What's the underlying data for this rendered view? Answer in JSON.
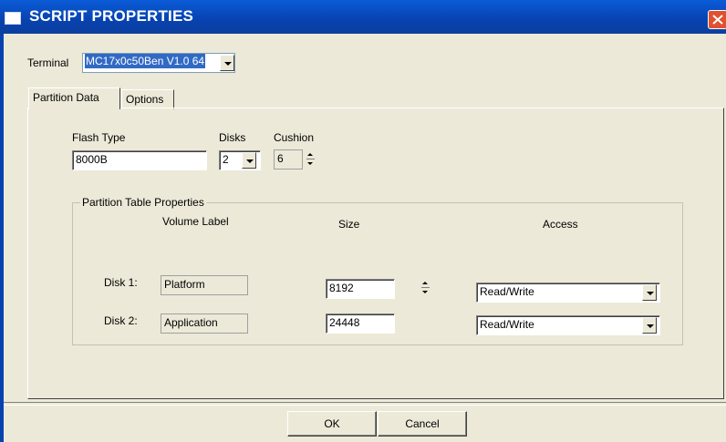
{
  "window": {
    "title": "SCRIPT PROPERTIES"
  },
  "terminal": {
    "label": "Terminal",
    "value": "MC17x0c50Ben V1.0 64"
  },
  "tabs": [
    {
      "label": "Partition Data",
      "active": true
    },
    {
      "label": "Options",
      "active": false
    }
  ],
  "partition": {
    "flash_type_label": "Flash Type",
    "flash_type_value": "8000B",
    "disks_label": "Disks",
    "disks_value": "2",
    "cushion_label": "Cushion",
    "cushion_value": "6",
    "group_title": "Partition Table Properties",
    "col_volume": "Volume Label",
    "col_size": "Size",
    "col_access": "Access",
    "rows": [
      {
        "disk": "Disk 1:",
        "volume": "Platform",
        "size": "8192",
        "access": "Read/Write"
      },
      {
        "disk": "Disk 2:",
        "volume": "Application",
        "size": "24448",
        "access": "Read/Write"
      }
    ]
  },
  "buttons": {
    "ok": "OK",
    "cancel": "Cancel"
  },
  "icons": {
    "window": "window-icon",
    "close": "close-icon",
    "dropdown": "chevron-down-icon",
    "spin": "spinner-arrows-icon"
  },
  "colors": {
    "titlebar": "#0842b0",
    "close": "#e0512f",
    "face": "#ece9d8",
    "selection": "#316ac5"
  }
}
